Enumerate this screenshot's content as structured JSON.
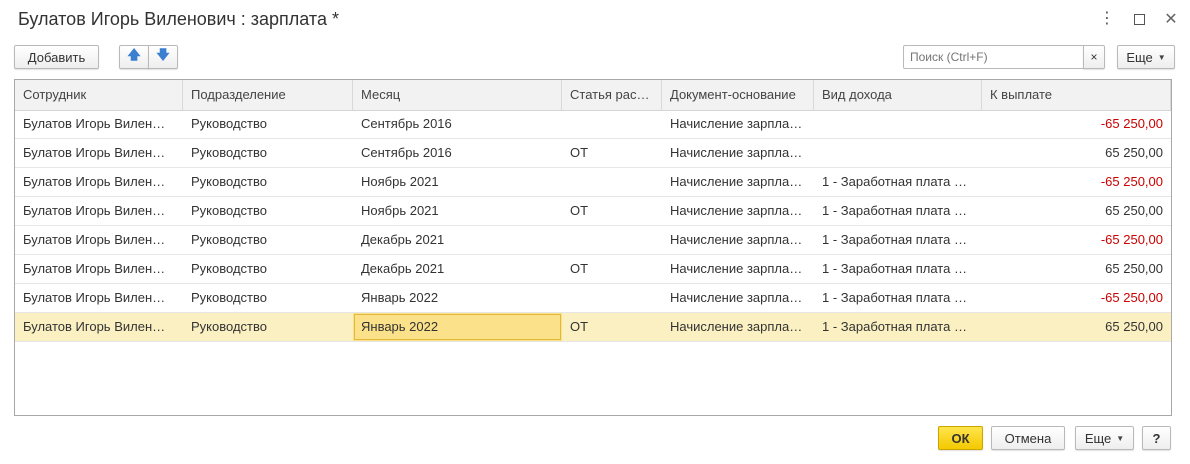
{
  "window": {
    "title": "Булатов Игорь Виленович : зарплата *",
    "icons": [
      "more-vertical-icon",
      "maximize-icon",
      "close-icon"
    ]
  },
  "toolbar": {
    "add_label": "Добавить",
    "up_icon": "arrow-up-icon",
    "down_icon": "arrow-down-icon",
    "search_placeholder": "Поиск (Ctrl+F)",
    "search_clear": "×",
    "more_label": "Еще"
  },
  "table": {
    "columns": [
      "Сотрудник",
      "Подразделение",
      "Месяц",
      "Статья рас…",
      "Документ-основание",
      "Вид дохода",
      "К выплате"
    ],
    "rows": [
      {
        "employee": "Булатов Игорь Вилен…",
        "department": "Руководство",
        "month": "Сентябрь 2016",
        "article": "",
        "document": "Начисление зарпла…",
        "income": "",
        "amount": "-65 250,00",
        "negative": true
      },
      {
        "employee": "Булатов Игорь Вилен…",
        "department": "Руководство",
        "month": "Сентябрь 2016",
        "article": "ОТ",
        "document": "Начисление зарпла…",
        "income": "",
        "amount": "65 250,00",
        "negative": false
      },
      {
        "employee": "Булатов Игорь Вилен…",
        "department": "Руководство",
        "month": "Ноябрь 2021",
        "article": "",
        "document": "Начисление зарпла…",
        "income": "1 - Заработная плата …",
        "amount": "-65 250,00",
        "negative": true
      },
      {
        "employee": "Булатов Игорь Вилен…",
        "department": "Руководство",
        "month": "Ноябрь 2021",
        "article": "ОТ",
        "document": "Начисление зарпла…",
        "income": "1 - Заработная плата …",
        "amount": "65 250,00",
        "negative": false
      },
      {
        "employee": "Булатов Игорь Вилен…",
        "department": "Руководство",
        "month": "Декабрь 2021",
        "article": "",
        "document": "Начисление зарпла…",
        "income": "1 - Заработная плата …",
        "amount": "-65 250,00",
        "negative": true
      },
      {
        "employee": "Булатов Игорь Вилен…",
        "department": "Руководство",
        "month": "Декабрь 2021",
        "article": "ОТ",
        "document": "Начисление зарпла…",
        "income": "1 - Заработная плата …",
        "amount": "65 250,00",
        "negative": false
      },
      {
        "employee": "Булатов Игорь Вилен…",
        "department": "Руководство",
        "month": "Январь 2022",
        "article": "",
        "document": "Начисление зарпла…",
        "income": "1 - Заработная плата …",
        "amount": "-65 250,00",
        "negative": true
      },
      {
        "employee": "Булатов Игорь Вилен…",
        "department": "Руководство",
        "month": "Январь 2022",
        "article": "ОТ",
        "document": "Начисление зарпла…",
        "income": "1 - Заработная плата …",
        "amount": "65 250,00",
        "negative": false
      }
    ],
    "selected_row": 7,
    "negative_color": "#cc0000",
    "selection_color": "#fbf0c2"
  },
  "footer": {
    "ok_label": "ОК",
    "cancel_label": "Отмена",
    "more_label": "Еще",
    "help_label": "?",
    "ok_color": "#f4c900"
  }
}
